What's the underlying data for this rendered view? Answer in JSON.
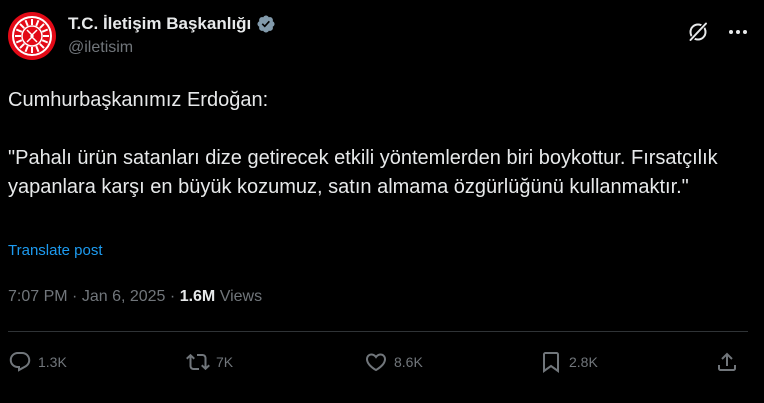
{
  "account": {
    "display_name": "T.C. İletişim Başkanlığı",
    "handle": "@iletisim",
    "verified_badge_color": "#829aab",
    "avatar_color": "#e30a17"
  },
  "post": {
    "line_1": "Cumhurbaşkanımız Erdoğan:",
    "line_2": "\"Pahalı ürün satanları dize getirecek etkili yöntemlerden biri boykottur. Fırsatçılık yapanlara karşı en büyük kozumuz, satın almama özgürlüğünü kullanmaktır.\"",
    "translate_label": "Translate post"
  },
  "meta": {
    "time": "7:07 PM",
    "separator": "·",
    "date": "Jan 6, 2025",
    "views_count": "1.6M",
    "views_label": "Views"
  },
  "actions": {
    "replies": "1.3K",
    "reposts": "7K",
    "likes": "8.6K",
    "bookmarks": "2.8K"
  },
  "icons": {
    "avatar": "star-crescent-emblem-icon",
    "verified": "verified-badge-icon",
    "grok": "grok-icon",
    "more": "more-icon",
    "reply": "reply-icon",
    "repost": "repost-icon",
    "like": "heart-icon",
    "bookmark": "bookmark-icon",
    "share": "share-icon"
  },
  "colors": {
    "background": "#000000",
    "text": "#e7e9ea",
    "secondary": "#71767b",
    "link": "#1d9bf0",
    "divider": "#2f3336"
  }
}
